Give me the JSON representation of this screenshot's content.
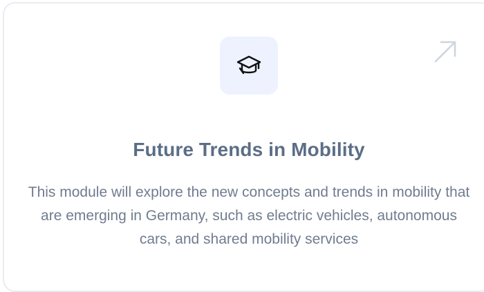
{
  "card": {
    "icon": "graduation-cap-icon",
    "link_icon": "arrow-up-right-icon",
    "title": "Future Trends in Mobility",
    "description": "This module will explore the new concepts and trends in mobility that are emerging in Germany, such as electric vehicles, autonomous cars, and shared mobility services"
  },
  "colors": {
    "icon_background": "#edf2fe",
    "title": "#5c6e86",
    "description": "#707c8e",
    "border": "#e8ecf1",
    "arrow": "#cfd5de"
  }
}
